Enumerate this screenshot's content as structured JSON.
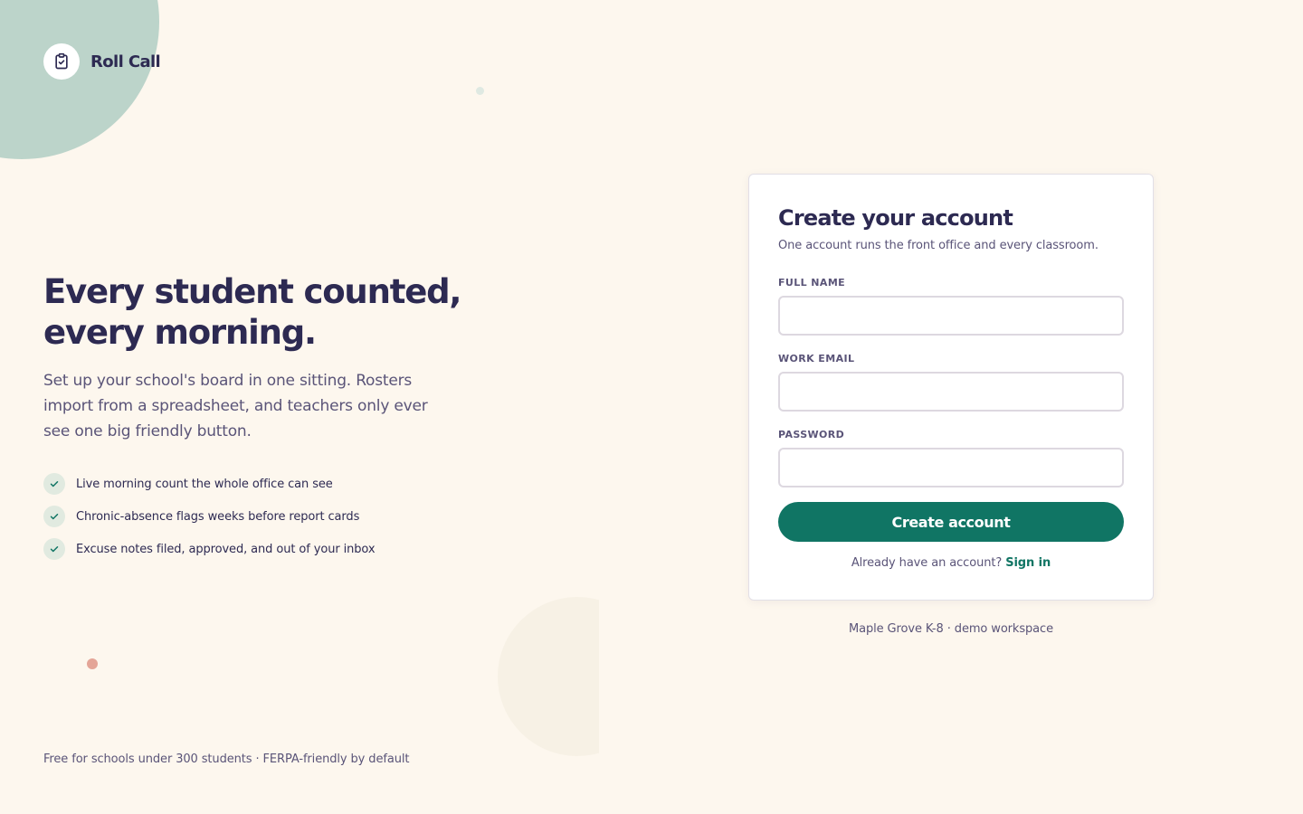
{
  "brand": {
    "name": "Roll Call",
    "icon": "clipboard-check-icon"
  },
  "hero": {
    "title": "Every student counted, every morning.",
    "subtitle": "Set up your school's board in one sitting. Rosters import from a spreadsheet, and teachers only ever see one big friendly button."
  },
  "features": [
    {
      "text": "Live morning count the whole office can see",
      "icon": "check-icon"
    },
    {
      "text": "Chronic-absence flags weeks before report cards",
      "icon": "check-icon"
    },
    {
      "text": "Excuse notes filed, approved, and out of your inbox",
      "icon": "check-icon"
    }
  ],
  "footnote": "Free for schools under 300 students · FERPA-friendly by default",
  "form": {
    "title": "Create your account",
    "subtitle": "One account runs the front office and every classroom.",
    "fields": {
      "full_name": {
        "label": "FULL NAME",
        "value": ""
      },
      "work_email": {
        "label": "WORK EMAIL",
        "value": ""
      },
      "password": {
        "label": "PASSWORD",
        "value": ""
      }
    },
    "submit_label": "Create account",
    "signin_prompt": "Already have an account?",
    "signin_link": "Sign in"
  },
  "workspace_note": "Maple Grove K-8 · demo workspace",
  "colors": {
    "background": "#fdf7ee",
    "accent": "#107564",
    "ink": "#2d2a52",
    "muted": "#5a5478",
    "blob": "#bcd4ca",
    "coral_dot": "#e4a597"
  }
}
